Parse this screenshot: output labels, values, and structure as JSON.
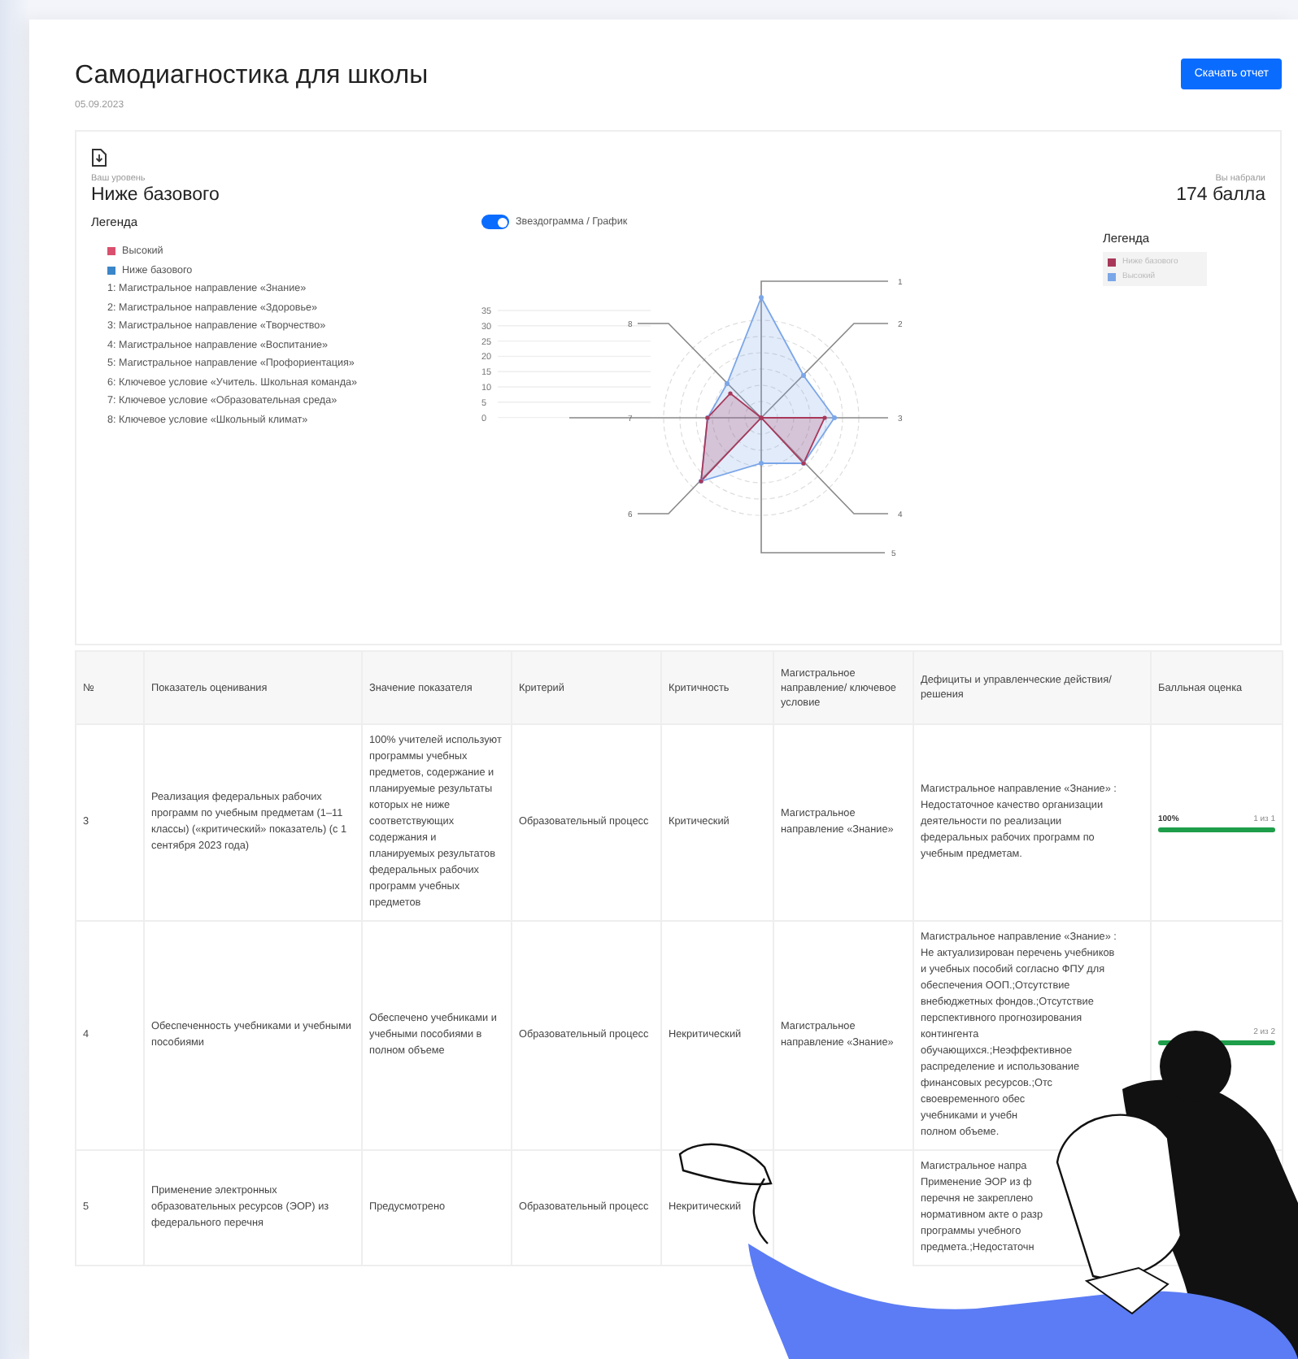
{
  "header": {
    "title": "Самодиагностика для школы",
    "date": "05.09.2023",
    "download_button": "Скачать отчет"
  },
  "summary": {
    "level_label": "Ваш уровень",
    "level": "Ниже базового",
    "score_label": "Вы набрали",
    "score": "174 балла"
  },
  "legend": {
    "title": "Легенда",
    "series": [
      {
        "label": "Высокий",
        "color": "#d9506e"
      },
      {
        "label": "Ниже базового",
        "color": "#3b86c8"
      }
    ],
    "axes": [
      "1: Магистральное направление «Знание»",
      "2: Магистральное направление «Здоровье»",
      "3: Магистральное направление «Творчество»",
      "4: Магистральное направление «Воспитание»",
      "5: Магистральное направление «Профориентация»",
      "6: Ключевое условие «Учитель. Школьная команда»",
      "7: Ключевое условие «Образовательная среда»",
      "8: Ключевое условие «Школьный климат»"
    ]
  },
  "chart_toggle": {
    "label": "Звездограмма / График",
    "on": true
  },
  "radar": {
    "ticks": [
      "35",
      "30",
      "25",
      "20",
      "15",
      "10",
      "5",
      "0"
    ],
    "axis_labels": [
      "1",
      "8",
      "2",
      "7",
      "3",
      "6",
      "4",
      "5"
    ],
    "legend_title": "Легенда",
    "series": [
      {
        "label": "Ниже базового",
        "color": "#a8385a"
      },
      {
        "label": "Высокий",
        "color": "#7ba6e8"
      }
    ]
  },
  "table": {
    "columns": [
      "№",
      "Показатель оценивания",
      "Значение показателя",
      "Критерий",
      "Критичность",
      "Магистральное направление/ ключевое условие",
      "Дефициты и управленческие действия/решения",
      "Балльная оценка"
    ],
    "rows": [
      {
        "number": "3",
        "indicator": "Реализация федеральных рабочих программ по учебным предметам (1–11 классы) («критический» показатель) (с 1 сентября 2023 года)",
        "value": "100% учителей используют программы учебных предметов, содержание и планируемые результаты которых не ниже соответствующих содержания и планируемых результатов федеральных рабочих программ учебных предметов",
        "criterion": "Образовательный процесс",
        "criticality": "Критический",
        "direction": "Магистральное направление «Знание»",
        "deficits": "Магистральное направление «Знание» :\nНедостаточное качество организации\nдеятельности по реализации\nфедеральных рабочих программ по\nучебным предметам.",
        "score": {
          "percent": "100%",
          "count": "1 из 1",
          "level": 1
        }
      },
      {
        "number": "4",
        "indicator": "Обеспеченность учебниками и учебными пособиями",
        "value": "Обеспечено учебниками и учебными пособиями в полном объеме",
        "criterion": "Образовательный процесс",
        "criticality": "Некритический",
        "direction": "Магистральное направление «Знание»",
        "deficits": "Магистральное направление «Знание» :\nНе актуализирован перечень учебников\nи учебных пособий согласно ФПУ для\nобеспечения ООП.;Отсутствие\nвнебюджетных фондов.;Отсутствие\nперспективного прогнозирования\nконтингента\nобучающихся.;Неэффективное\nраспределение и использование\nфинансовых ресурсов.;Отс\nсвоевременного обес\nучебниками и учебн\nполном объеме.",
        "score": {
          "count": "2 из 2",
          "level": 1
        }
      },
      {
        "number": "5",
        "indicator": "Применение электронных образовательных ресурсов (ЭОР) из федерального перечня",
        "value": "Предусмотрено",
        "criterion": "Образовательный процесс",
        "criticality": "Некритический",
        "deficits": "Магистральное напра\nПрименение ЭОР из ф\nперечня не закреплено\nнормативном акте о разр\nпрограммы учебного\nпредмета.;Недостаточн"
      }
    ]
  }
}
